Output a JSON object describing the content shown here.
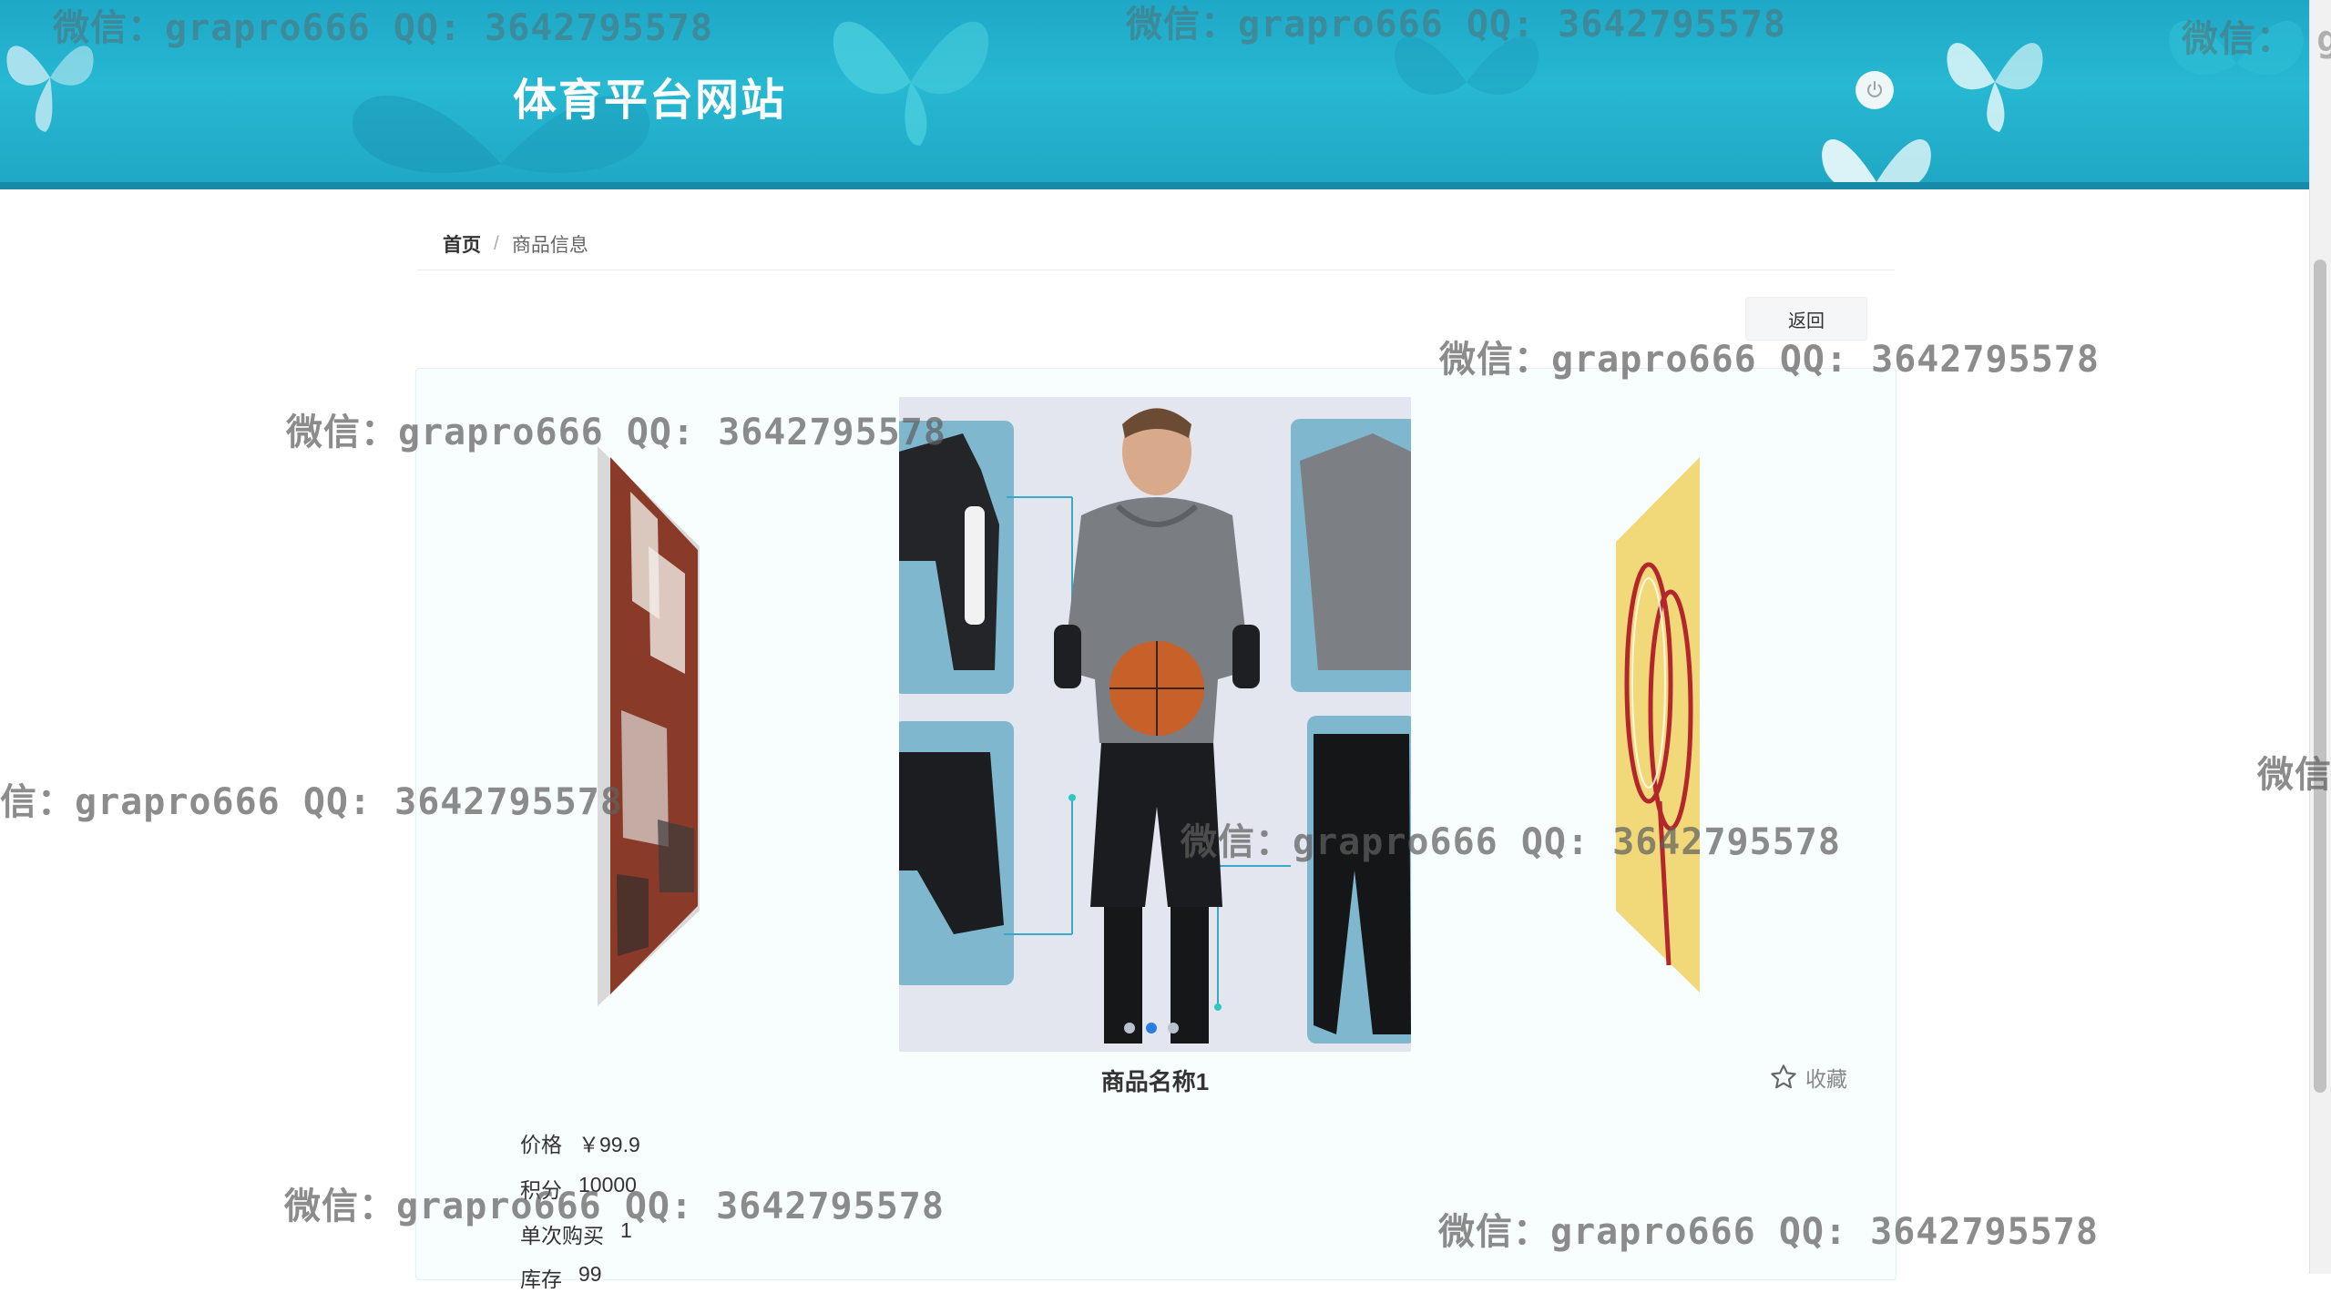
{
  "header": {
    "site_title": "体育平台网站",
    "logout_icon": "power-icon"
  },
  "breadcrumb": {
    "home": "首页",
    "separator": "/",
    "current": "商品信息"
  },
  "actions": {
    "back_label": "返回",
    "favorite_label": "收藏",
    "favorite_icon": "star-icon"
  },
  "carousel": {
    "slide_count": 3,
    "active_index": 1,
    "slides": [
      "basketball-apparel-photo",
      "event-collage-photo",
      "badminton-racket-photo"
    ]
  },
  "product": {
    "name": "商品名称1",
    "fields": [
      {
        "label": "价格",
        "value": "￥99.9"
      },
      {
        "label": "积分",
        "value": "10000"
      },
      {
        "label": "单次购买",
        "value": "1"
      },
      {
        "label": "库存",
        "value": "99"
      }
    ]
  },
  "watermark": {
    "text": "微信：grapro666 QQ: 3642795578",
    "cut_left": "信：grapro666 QQ: 3642795578",
    "cut_right_short": "微信",
    "cut_right_tiny": "微信： gr"
  },
  "colors": {
    "header_bg": "#1ea8c7",
    "accent_blue": "#2a7de1",
    "card_bg": "#f8fdfe"
  }
}
